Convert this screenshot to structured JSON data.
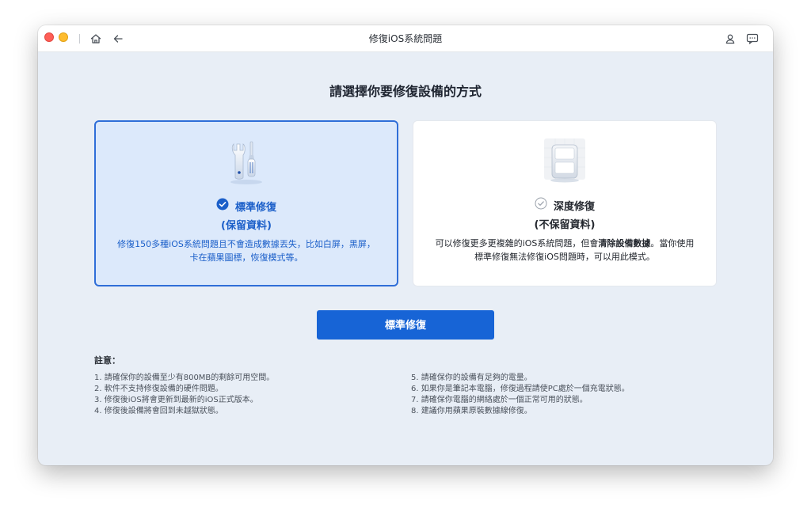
{
  "window": {
    "title": "修復iOS系統問題"
  },
  "heading": "請選擇你要修復設備的方式",
  "cards": {
    "standard": {
      "title": "標準修復",
      "subtitle": "(保留資料)",
      "description": "修復150多種iOS系統問題且不會造成數據丟失，比如白屏，黑屏，卡在蘋果圖標，恢復模式等。",
      "selected": true
    },
    "deep": {
      "title": "深度修復",
      "subtitle": "(不保留資料)",
      "description_before": "可以修復更多更複雜的iOS系統問題，但會",
      "description_bold": "清除設備數據",
      "description_after": "。當你使用標準修復無法修復iOS問題時，可以用此模式。",
      "selected": false
    }
  },
  "primary_button": "標準修復",
  "notes": {
    "title": "註意：",
    "left": [
      "1. 請確保你的設備至少有800MB的剩餘可用空間。",
      "2. 軟件不支持修復設備的硬件問題。",
      "3. 修復後iOS將會更新到最新的iOS正式版本。",
      "4. 修復後設備將會回到未越獄狀態。"
    ],
    "right": [
      "5. 請確保你的設備有足夠的電量。",
      "6. 如果你是筆記本電腦，修復過程請使PC處於一個充電狀態。",
      "7. 請確保你電腦的網絡處於一個正常可用的狀態。",
      "8. 建議你用蘋果原裝數據線修復。"
    ]
  },
  "icons": {
    "home": "home-icon",
    "back": "back-arrow-icon",
    "user": "user-icon",
    "feedback": "feedback-icon",
    "standard_illustration": "wrench-screwdriver-icon",
    "deep_illustration": "device-repair-icon",
    "selected_check": "check-circle-icon",
    "unselected_check": "check-circle-outline-icon"
  },
  "colors": {
    "accent": "#1764d6",
    "selected_card_bg": "#dce9fb",
    "window_bg": "#e8eef6"
  }
}
